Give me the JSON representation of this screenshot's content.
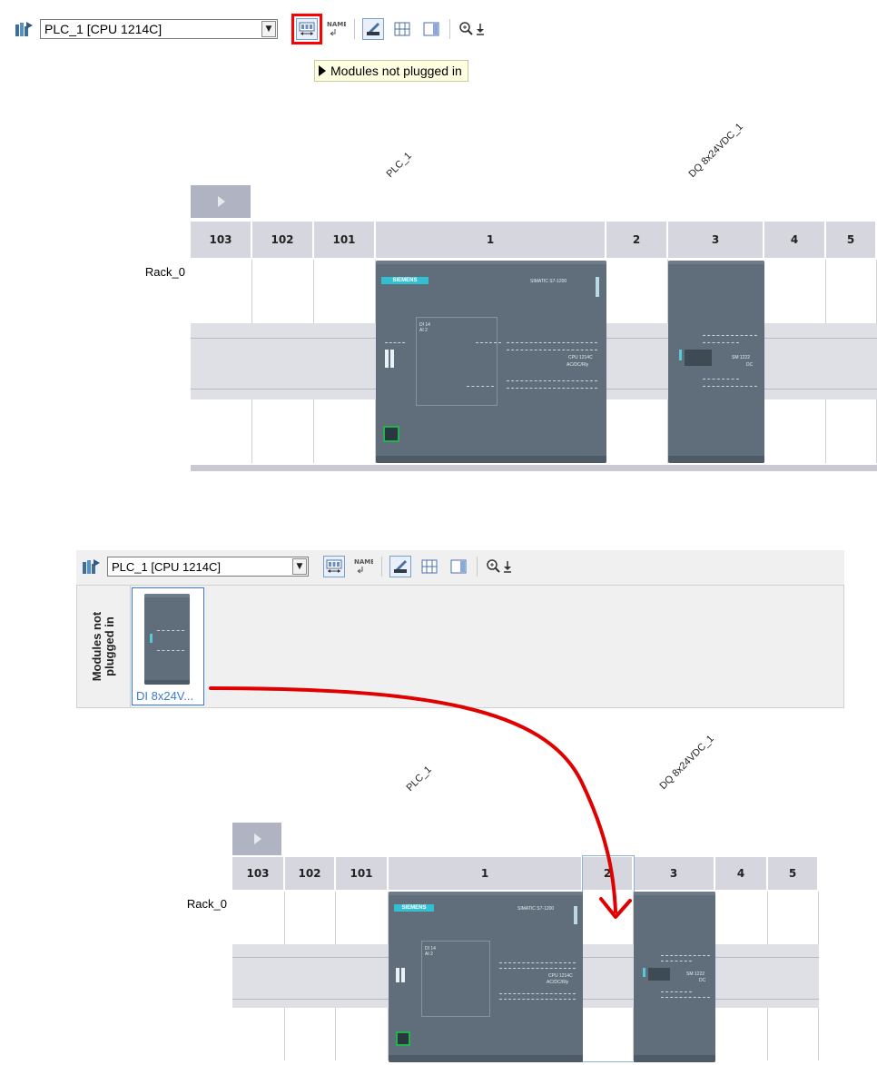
{
  "top": {
    "device_select": "PLC_1 [CPU 1214C]",
    "tooltip": "Modules not plugged in",
    "device_label": "PLC_1",
    "module_label": "DQ 8x24VDC_1",
    "rack_name": "Rack_0",
    "slots": [
      "103",
      "102",
      "101",
      "1",
      "2",
      "3",
      "4",
      "5"
    ]
  },
  "cpu": {
    "brand": "SIEMENS",
    "model_text": "SIMATIC S7-1200",
    "cpu_text": "CPU 1214C",
    "cpu_sub": "AC/DC/Rly"
  },
  "sm": {
    "text": "SM 1222",
    "sub": "DC"
  },
  "bottom": {
    "device_select": "PLC_1 [CPU 1214C]",
    "panel_title": "Modules not plugged in",
    "module_card_label": "DI 8x24V...",
    "device_label": "PLC_1",
    "module_label": "DQ 8x24VDC_1",
    "rack_name": "Rack_0",
    "slots": [
      "103",
      "102",
      "101",
      "1",
      "2",
      "3",
      "4",
      "5"
    ]
  },
  "colors": {
    "highlight": "#ff0000",
    "arrow": "#e00000",
    "module": "#5f6e7a",
    "selection": "#3a78d6"
  },
  "icons": [
    "network-view-icon",
    "modules-not-plugged-icon",
    "show-names-icon",
    "view-icon",
    "grid-icon",
    "table-icon",
    "zoom-icon"
  ]
}
